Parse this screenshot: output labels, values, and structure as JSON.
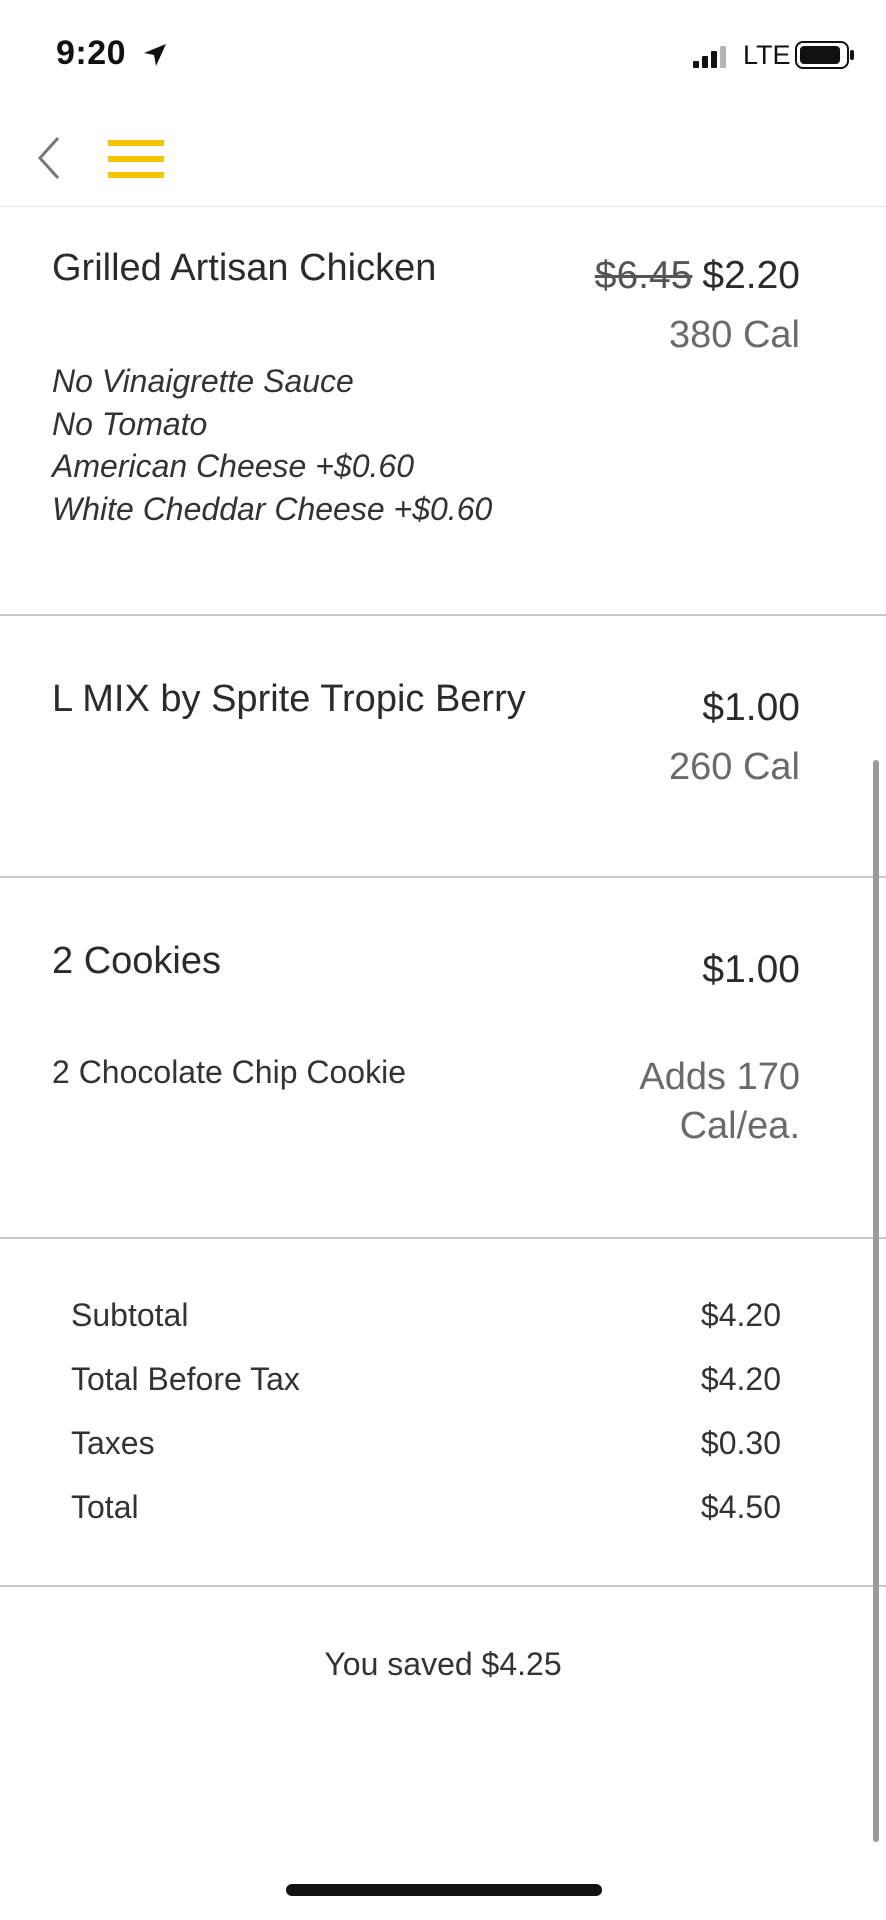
{
  "status_bar": {
    "time": "9:20",
    "network": "LTE",
    "icons": [
      "location-arrow-icon",
      "signal-icon",
      "battery-icon"
    ]
  },
  "nav": {
    "icons": [
      "chevron-left-icon",
      "hamburger-menu-icon"
    ],
    "accent_color": "#F5C400"
  },
  "items": [
    {
      "name": "Grilled Artisan Chicken",
      "old_price": "$6.45",
      "price": "$2.20",
      "calories": "380 Cal",
      "modifiers": [
        "No Vinaigrette Sauce",
        "No Tomato",
        "American Cheese +$0.60",
        "White Cheddar Cheese +$0.60"
      ]
    },
    {
      "name": "L MIX by Sprite Tropic Berry",
      "price": "$1.00",
      "calories": "260 Cal"
    },
    {
      "name": "2 Cookies",
      "price": "$1.00",
      "sub_item": "2 Chocolate Chip Cookie",
      "sub_calories_line1": "Adds 170",
      "sub_calories_line2": "Cal/ea."
    }
  ],
  "totals": [
    {
      "label": "Subtotal",
      "value": "$4.20"
    },
    {
      "label": "Total Before Tax",
      "value": "$4.20"
    },
    {
      "label": "Taxes",
      "value": "$0.30"
    },
    {
      "label": "Total",
      "value": "$4.50"
    }
  ],
  "savings_text": "You saved $4.25"
}
